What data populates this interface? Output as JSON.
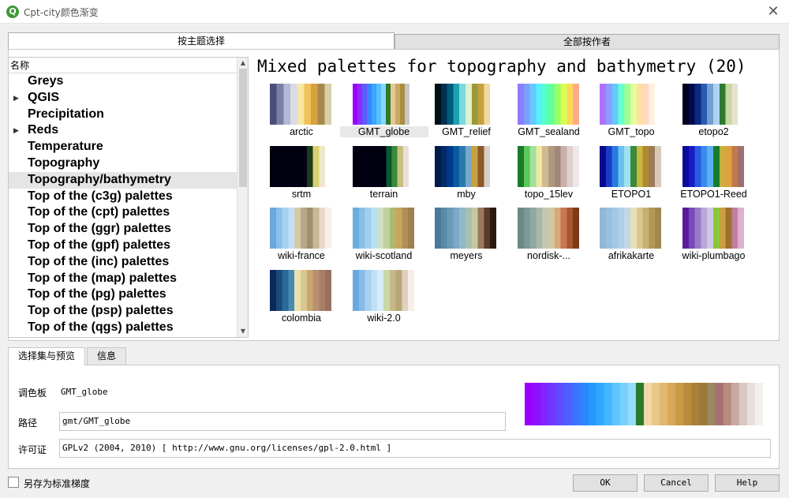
{
  "window": {
    "title": "Cpt-city颜色渐变",
    "logo_letter": "Q",
    "close_glyph": "✕"
  },
  "top_tabs": [
    {
      "label": "按主题选择",
      "active": true
    },
    {
      "label": "全部按作者",
      "active": false
    }
  ],
  "tree": {
    "header": "名称",
    "items": [
      {
        "label": "Greys",
        "expandable": false,
        "selected": false
      },
      {
        "label": "QGIS",
        "expandable": true,
        "selected": false
      },
      {
        "label": "Precipitation",
        "expandable": false,
        "selected": false
      },
      {
        "label": "Reds",
        "expandable": true,
        "selected": false
      },
      {
        "label": "Temperature",
        "expandable": false,
        "selected": false
      },
      {
        "label": "Topography",
        "expandable": false,
        "selected": false
      },
      {
        "label": "Topography/bathymetry",
        "expandable": false,
        "selected": true
      },
      {
        "label": "Top of the (c3g) palettes",
        "expandable": false,
        "selected": false
      },
      {
        "label": "Top of the (cpt) palettes",
        "expandable": false,
        "selected": false
      },
      {
        "label": "Top of the (ggr) palettes",
        "expandable": false,
        "selected": false
      },
      {
        "label": "Top of the (gpf) palettes",
        "expandable": false,
        "selected": false
      },
      {
        "label": "Top of the (inc) palettes",
        "expandable": false,
        "selected": false
      },
      {
        "label": "Top of the (map) palettes",
        "expandable": false,
        "selected": false
      },
      {
        "label": "Top of the (pg) palettes",
        "expandable": false,
        "selected": false
      },
      {
        "label": "Top of the (psp) palettes",
        "expandable": false,
        "selected": false
      },
      {
        "label": "Top of the (qgs) palettes",
        "expandable": false,
        "selected": false
      }
    ],
    "expand_glyph": "▶",
    "scroll_up": "▲",
    "scroll_down": "▼"
  },
  "gallery": {
    "heading": "Mixed palettes for topography and bathymetry (20)",
    "palettes": [
      {
        "name": "arctic",
        "selected": false,
        "colors": [
          "#4a4f7a",
          "#7a7fa8",
          "#b4b8d4",
          "#d8dbe8",
          "#f6e7a3",
          "#efc35a",
          "#d6a23c",
          "#a8884a",
          "#d8cfa8"
        ]
      },
      {
        "name": "GMT_globe",
        "selected": true,
        "colors": [
          "#9b00ff",
          "#8a2cff",
          "#5f5bff",
          "#3a82ff",
          "#3ca5ff",
          "#55c2ff",
          "#8ad6ff",
          "#2f7a2a",
          "#e8c890",
          "#c9a86a",
          "#a98c3c",
          "#c7c7c7",
          "#ffffff"
        ]
      },
      {
        "name": "GMT_relief",
        "selected": false,
        "colors": [
          "#001018",
          "#003050",
          "#005a7a",
          "#1aa0b0",
          "#7ad8e0",
          "#e0f0d0",
          "#9a9a3a",
          "#c8a040",
          "#f0d8a0",
          "#ffffff"
        ]
      },
      {
        "name": "GMT_sealand",
        "selected": false,
        "colors": [
          "#8c7cff",
          "#7aa0ff",
          "#66c8ff",
          "#55f0ff",
          "#55ffc8",
          "#66ff99",
          "#9aff66",
          "#d8ff55",
          "#ffd855",
          "#ffaa88"
        ]
      },
      {
        "name": "GMT_topo",
        "selected": false,
        "colors": [
          "#b070ff",
          "#8a9cff",
          "#66c8ff",
          "#66ffd0",
          "#99ff99",
          "#e8ff99",
          "#ffe0a0",
          "#ffd8c0",
          "#fff0e0",
          "#ffffff"
        ]
      },
      {
        "name": "etopo2",
        "selected": false,
        "colors": [
          "#000020",
          "#000850",
          "#0a2a80",
          "#2a5ab0",
          "#6fa0d0",
          "#b0d0f0",
          "#2e7a30",
          "#c8d8a0",
          "#e8e0d0",
          "#ffffff"
        ]
      },
      {
        "name": "srtm",
        "selected": false,
        "colors": [
          "#000010",
          "#000010",
          "#000010",
          "#000010",
          "#000010",
          "#000010",
          "#1c3a1c",
          "#d8d070",
          "#f0e8c8",
          "#ffffff"
        ]
      },
      {
        "name": "terrain",
        "selected": false,
        "colors": [
          "#000010",
          "#000010",
          "#000010",
          "#000010",
          "#000010",
          "#000010",
          "#0a5a30",
          "#3a8a3a",
          "#c8c080",
          "#e8e0d8",
          "#ffffff"
        ]
      },
      {
        "name": "mby",
        "selected": false,
        "colors": [
          "#001a4a",
          "#002a6a",
          "#003a8a",
          "#0a5aa0",
          "#2a7ab0",
          "#7aa8c8",
          "#c8a040",
          "#8a5a2a",
          "#d8d0c8",
          "#ffffff"
        ]
      },
      {
        "name": "topo_15lev",
        "selected": false,
        "colors": [
          "#1a7a2a",
          "#5ac85a",
          "#a0e0a0",
          "#f0e8a0",
          "#d0b890",
          "#b09880",
          "#a08878",
          "#c8b0a8",
          "#e0d0d0",
          "#f0e8e8"
        ]
      },
      {
        "name": "ETOPO1",
        "selected": false,
        "colors": [
          "#0a0a8a",
          "#1a3ac8",
          "#2a7ae0",
          "#6ac0f0",
          "#a0e0f0",
          "#3a8a3a",
          "#c8b840",
          "#b08830",
          "#9a7a5a",
          "#d8c8b8"
        ]
      },
      {
        "name": "ETOPO1-Reed",
        "selected": false,
        "colors": [
          "#0a0a9a",
          "#1a1ac8",
          "#2a5ae0",
          "#3a8af0",
          "#5ab0f0",
          "#1a7a2a",
          "#c8b040",
          "#e0a040",
          "#c07a4a",
          "#a07070"
        ]
      },
      {
        "name": "wiki-france",
        "selected": false,
        "colors": [
          "#6aa8e0",
          "#8ac0e8",
          "#a8d0f0",
          "#c0e0f8",
          "#d8c8a8",
          "#b8a888",
          "#a09070",
          "#c8b898",
          "#e8d8c8",
          "#f8f0e8"
        ]
      },
      {
        "name": "wiki-scotland",
        "selected": false,
        "colors": [
          "#6aaee0",
          "#88c0e8",
          "#a0d0f0",
          "#b8e0f0",
          "#d0e0c0",
          "#c0d0a0",
          "#b0b870",
          "#c8a858",
          "#b09058",
          "#a08050"
        ]
      },
      {
        "name": "meyers",
        "selected": false,
        "colors": [
          "#4a7a9a",
          "#5a8aa8",
          "#6a9ab8",
          "#7aaac8",
          "#90b8c8",
          "#a8c0b0",
          "#c8c8a0",
          "#9a7a5a",
          "#5a3a2a",
          "#2a1a10"
        ]
      },
      {
        "name": "nordisk-...",
        "selected": false,
        "colors": [
          "#6a8a88",
          "#7a9a98",
          "#90a8a0",
          "#a8b8a8",
          "#c0c8b0",
          "#d0c8a0",
          "#d8a878",
          "#c87850",
          "#a85830",
          "#803818"
        ]
      },
      {
        "name": "afrikakarte",
        "selected": false,
        "colors": [
          "#90b8d8",
          "#98c0e0",
          "#a0c8e8",
          "#b0d0e8",
          "#c0d8e8",
          "#e8e0b8",
          "#d8c890",
          "#c8b070",
          "#b09858",
          "#a08850"
        ]
      },
      {
        "name": "wiki-plumbago",
        "selected": false,
        "colors": [
          "#5a1aa0",
          "#7a4ab8",
          "#9a7ac8",
          "#b8a8d8",
          "#d0c8e0",
          "#8ac83a",
          "#c8a040",
          "#a07030",
          "#c080a0",
          "#e0b0d0"
        ]
      },
      {
        "name": "colombia",
        "selected": false,
        "colors": [
          "#0a2a5a",
          "#1a4a7a",
          "#2a6a9a",
          "#4a8ab0",
          "#e8e0b0",
          "#d8c890",
          "#c8a870",
          "#b89070",
          "#a88068",
          "#987060"
        ]
      },
      {
        "name": "wiki-2.0",
        "selected": false,
        "colors": [
          "#6aa8e0",
          "#88bce8",
          "#a8d0f0",
          "#c0e0f8",
          "#d8ecf8",
          "#c8d8a8",
          "#c8b888",
          "#b8a878",
          "#e0d0c0",
          "#f8f0e8"
        ]
      }
    ]
  },
  "bottom_tabs": [
    {
      "label": "选择集与预览",
      "active": true
    },
    {
      "label": "信息",
      "active": false
    }
  ],
  "details": {
    "palette_label": "调色板",
    "palette_value": "GMT_globe",
    "path_label": "路径",
    "path_value": "gmt/GMT_globe",
    "license_label": "许可证",
    "license_value": "GPLv2 (2004, 2010)  [ http://www.gnu.org/licenses/gpl-2.0.html ]",
    "preview_colors": [
      "#9b00ff",
      "#8e10ff",
      "#8224ff",
      "#7038ff",
      "#5e4cff",
      "#4c60ff",
      "#3a74ff",
      "#2c86ff",
      "#2698ff",
      "#30a8ff",
      "#44b6ff",
      "#5ec4ff",
      "#78d0ff",
      "#96dcff",
      "#2a7a2a",
      "#f0d8a8",
      "#e8c88a",
      "#e0b870",
      "#d8a858",
      "#c89a44",
      "#b88c3c",
      "#a88038",
      "#9a7a3a",
      "#9a8860",
      "#a87070",
      "#b88a80",
      "#c8a8a0",
      "#d8c8c0",
      "#e8e0dc",
      "#f4f0ee",
      "#ffffff"
    ]
  },
  "footer": {
    "save_as_standard_label": "另存为标准梯度",
    "save_as_standard_checked": false,
    "ok_label": "OK",
    "cancel_label": "Cancel",
    "help_label": "Help"
  }
}
